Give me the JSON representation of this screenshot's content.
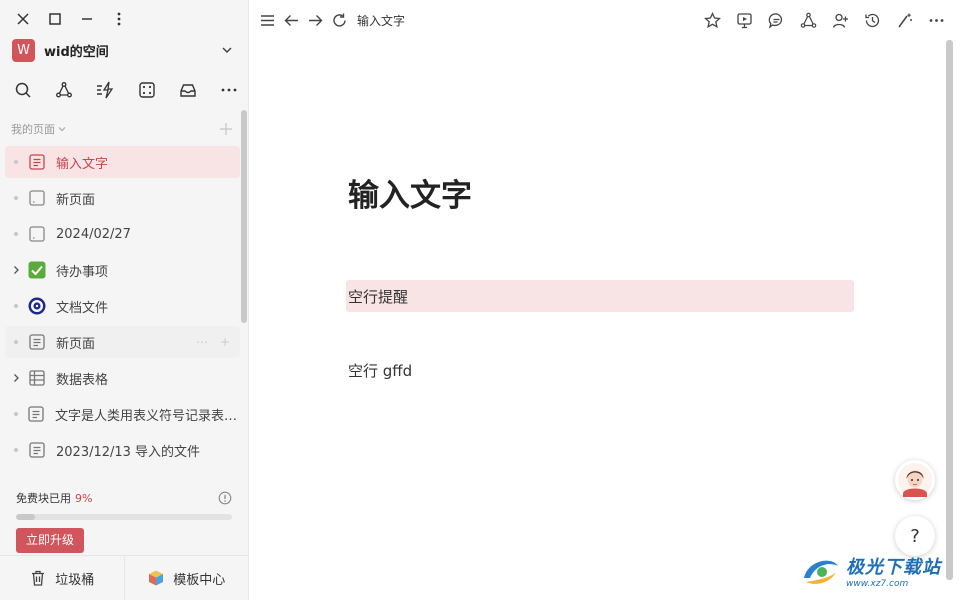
{
  "window_controls": [
    "close",
    "maximize",
    "minimize",
    "more"
  ],
  "workspace": {
    "avatar_letter": "W",
    "name": "wid的空间",
    "avatar_color": "#d4545c"
  },
  "toolbar_icons": [
    "search-icon",
    "graph-icon",
    "flash-icon",
    "dice-icon",
    "inbox-icon",
    "more-icon"
  ],
  "sidebar_section": {
    "title": "我的页面"
  },
  "pages": [
    {
      "label": "输入文字",
      "icon": "doc-icon",
      "lead": "dot",
      "state": "active"
    },
    {
      "label": "新页面",
      "icon": "blank-page-icon",
      "lead": "dot",
      "state": ""
    },
    {
      "label": "2024/02/27",
      "icon": "blank-page-icon",
      "lead": "dot",
      "state": ""
    },
    {
      "label": "待办事项",
      "icon": "checkbox-icon",
      "lead": "expand",
      "state": ""
    },
    {
      "label": "文档文件",
      "icon": "target-icon",
      "lead": "dot",
      "state": ""
    },
    {
      "label": "新页面",
      "icon": "doc-icon",
      "lead": "dot",
      "state": "hovered"
    },
    {
      "label": "数据表格",
      "icon": "table-icon",
      "lead": "expand",
      "state": ""
    },
    {
      "label": "文字是人类用表义符号记录表达信息以传之久远的方式和工具",
      "icon": "doc-icon",
      "lead": "dot",
      "state": ""
    },
    {
      "label": "2023/12/13 导入的文件",
      "icon": "doc-icon",
      "lead": "dot",
      "state": ""
    }
  ],
  "quota": {
    "label": "免费块已用",
    "percent_text": "9%",
    "percent": 9,
    "upgrade_label": "立即升级"
  },
  "footer": {
    "trash_label": "垃圾桶",
    "templates_label": "模板中心"
  },
  "topbar": {
    "breadcrumb": "输入文字"
  },
  "document": {
    "title": "输入文字",
    "blocks": [
      {
        "text": "空行提醒",
        "highlighted": true
      },
      {
        "text": "空行 gffd",
        "highlighted": false
      }
    ]
  },
  "help_label": "?",
  "watermark": {
    "main": "极光下载站",
    "sub": "www.xz7.com"
  },
  "colors": {
    "accent": "#d1555c",
    "active_bg": "#f8e4e5",
    "sidebar_bg": "#f5f5f5"
  }
}
